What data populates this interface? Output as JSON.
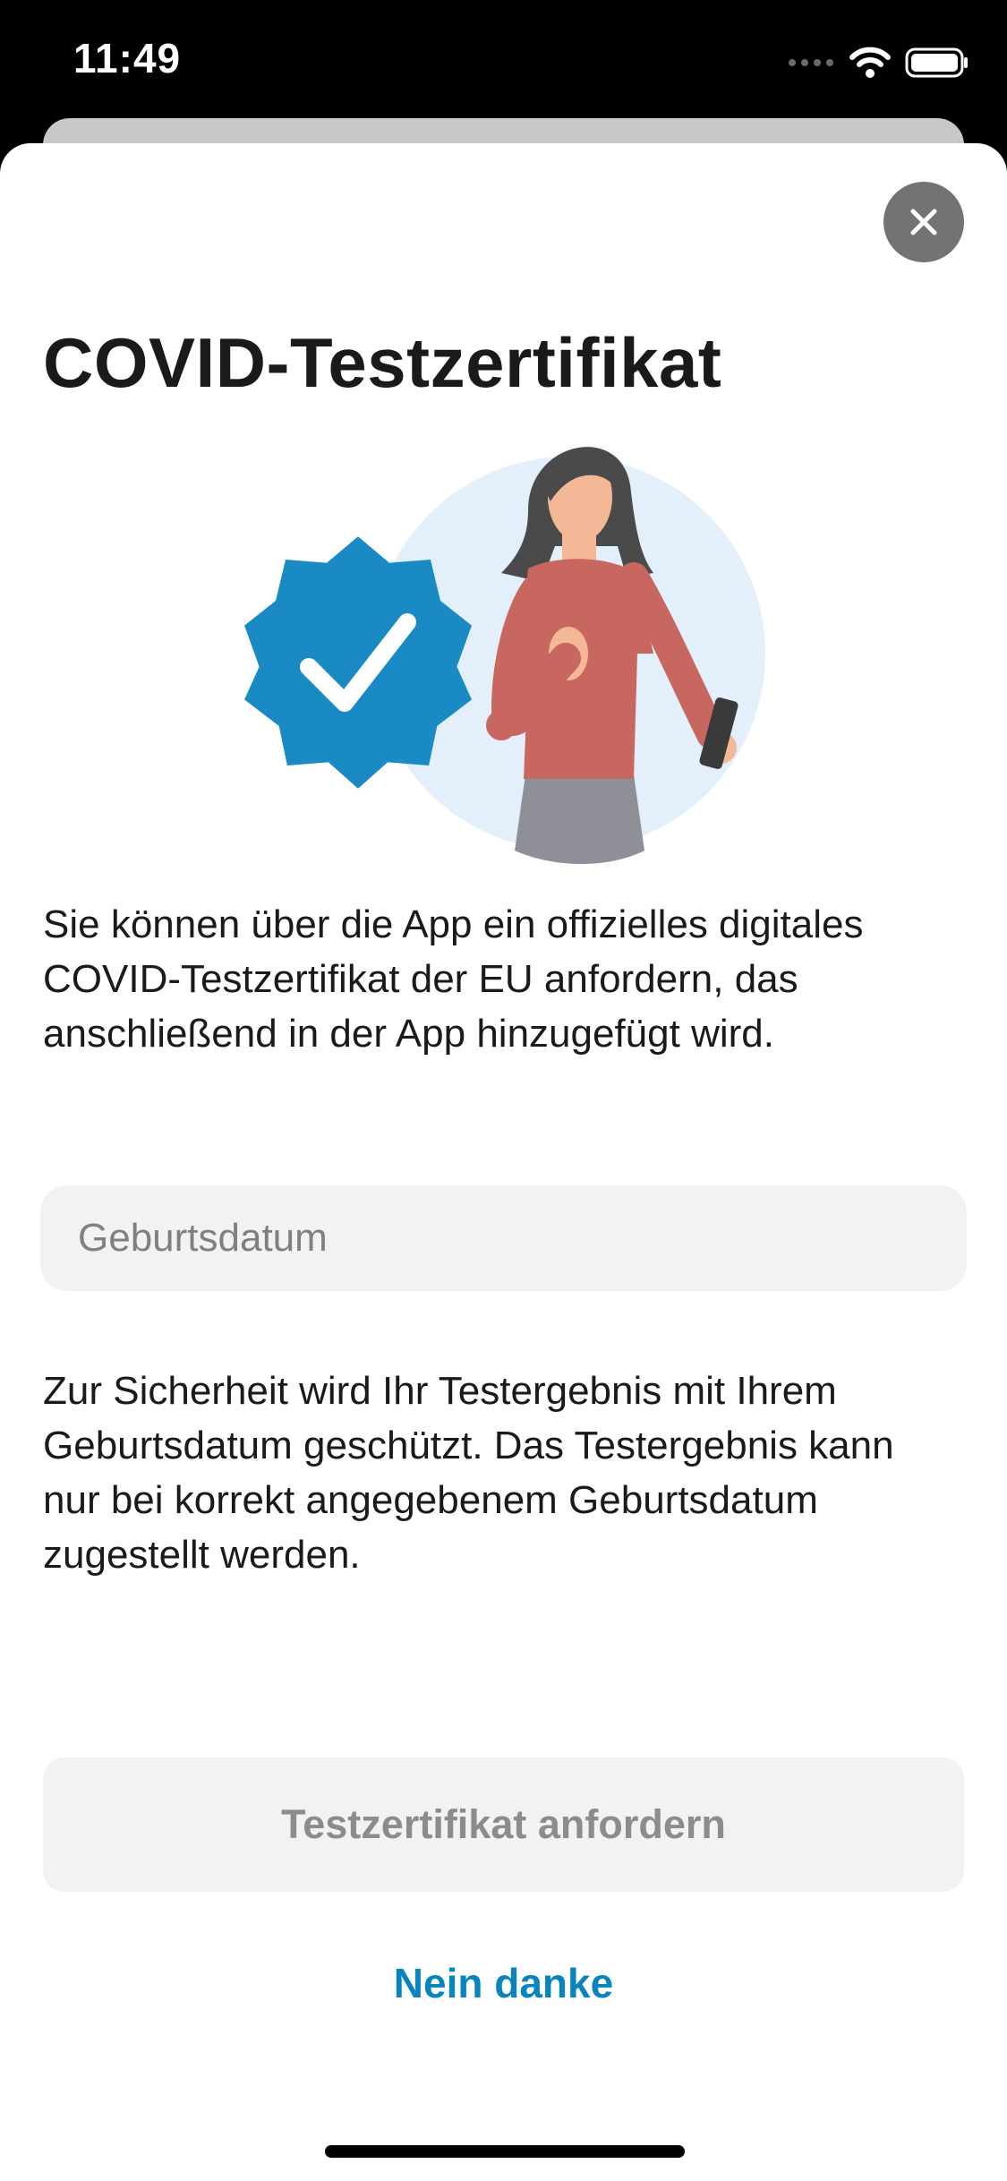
{
  "status_bar": {
    "time": "11:49"
  },
  "sheet": {
    "title": "COVID-Testzertifikat",
    "intro": "Sie können über die App ein offizielles digitales COVID-Testzertifikat der EU anfordern, das anschließend in der App hinzugefügt wird.",
    "birthdate_field": {
      "placeholder": "Geburtsdatum",
      "value": ""
    },
    "security_note": "Zur Sicherheit wird Ihr Testergebnis mit Ihrem Geburtsdatum geschützt. Das Testergebnis kann nur bei korrekt angegebenem Geburtsdatum zugestellt werden.",
    "primary_button": "Testzertifikat anfordern",
    "secondary_button": "Nein danke"
  },
  "icons": {
    "close": "close-icon",
    "illustration": "verified-badge-woman-with-phone-illustration"
  },
  "colors": {
    "accent": "#0a84bf",
    "badge": "#1a8ac4",
    "illustration_circle": "#e3effa",
    "shirt": "#c8675f",
    "disabled_button_bg": "#f2f2f2",
    "disabled_button_text": "#8c8c8c"
  }
}
